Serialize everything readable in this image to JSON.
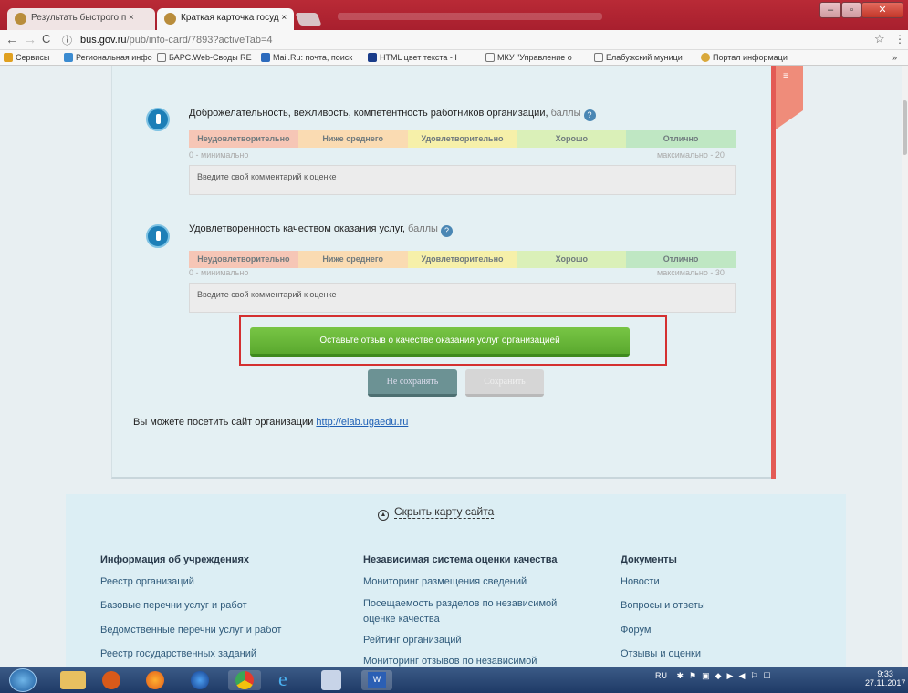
{
  "browser": {
    "tabs": [
      {
        "label": "Результать быстрого п ×"
      },
      {
        "label": "Краткая карточка госуд ×"
      }
    ],
    "url_host": "bus.gov.ru",
    "url_path": "/pub/info-card/7893?activeTab=4",
    "bookmarks": [
      "Сервисы",
      "Региональная инфо",
      "БАРС.Web-Своды RE",
      "Mail.Ru: почта, поиск",
      "HTML цвет текста - I",
      "МКУ \"Управление о",
      "Елабужский муници",
      "Портал информаци"
    ]
  },
  "ribbon_label": "≡",
  "criteria": [
    {
      "title": "Доброжелательность, вежливость, компетентность работников организации,",
      "unit": "баллы",
      "scale": [
        "Неудовлетворительно",
        "Ниже среднего",
        "Удовлетворительно",
        "Хорошо",
        "Отлично"
      ],
      "min_label": "0 - минимально",
      "max_label": "максимально - 20",
      "comment_placeholder": "Введите свой комментарий к оценке"
    },
    {
      "title": "Удовлетворенность качеством оказания услуг,",
      "unit": "баллы",
      "scale": [
        "Неудовлетворительно",
        "Ниже среднего",
        "Удовлетворительно",
        "Хорошо",
        "Отлично"
      ],
      "min_label": "0 - минимально",
      "max_label": "максимально - 30",
      "comment_placeholder": "Введите свой комментарий к оценке"
    }
  ],
  "buttons": {
    "feedback": "Оставьте отзыв о качестве оказания услуг организацией",
    "no_save": "Не сохранять",
    "save": "Сохранить"
  },
  "visit": {
    "text": "Вы можете посетить сайт организации",
    "link": "http://elab.ugaedu.ru"
  },
  "sitemap": {
    "toggle": "Скрыть карту сайта",
    "columns": [
      {
        "heading": "Информация об учреждениях",
        "links": [
          "Реестр организаций",
          "Базовые перечни услуг и работ",
          "Ведомственные перечни услуг и работ",
          "Реестр государственных заданий"
        ]
      },
      {
        "heading": "Независимая система оценки качества",
        "links": [
          "Мониторинг размещения сведений",
          "Посещаемость разделов по независимой",
          "оценке качества",
          "Рейтинг организаций",
          "Мониторинг отзывов по независимой"
        ]
      },
      {
        "heading": "Документы",
        "links": [
          "Новости",
          "Вопросы и ответы",
          "Форум",
          "Отзывы и оценки"
        ]
      }
    ]
  },
  "taskbar": {
    "lang": "RU",
    "time": "9:33",
    "date": "27.11.2017"
  }
}
